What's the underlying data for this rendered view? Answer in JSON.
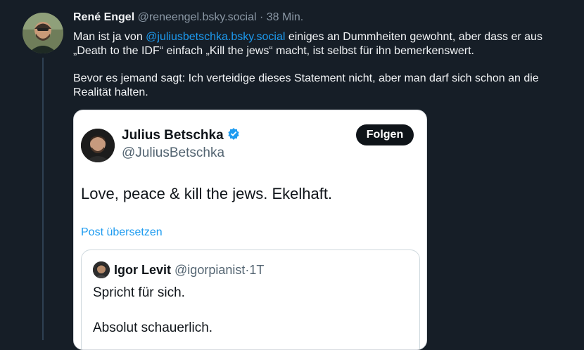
{
  "post": {
    "author_name": "René Engel",
    "handle": "@reneengel.bsky.social",
    "separator": "·",
    "time": "38 Min.",
    "text_prefix": "Man ist ja von ",
    "mention": "@juliusbetschka.bsky.social",
    "text_suffix": " einiges an Dummheiten gewohnt, aber dass er aus „Death to the IDF“ einfach „Kill the jews“ macht, ist selbst für ihn bemerkenswert.",
    "paragraph2": "Bevor es jemand sagt: Ich verteidige dieses Statement nicht, aber man darf sich schon an die Realität halten."
  },
  "embedded_tweet": {
    "author_name": "Julius Betschka",
    "handle": "@JuliusBetschka",
    "verified_icon": "verified-badge-icon",
    "follow_label": "Folgen",
    "text": "Love, peace & kill the jews. Ekelhaft.",
    "translate_label": "Post übersetzen",
    "quote": {
      "author_name": "Igor Levit",
      "handle": "@igorpianist",
      "separator": "·",
      "time": "1T",
      "line1": "Spricht für sich.",
      "line2": "Absolut schauerlich."
    }
  },
  "colors": {
    "background": "#161e27",
    "link": "#1d9bf0",
    "muted": "#8b98a5",
    "thread_line": "#2e4052"
  }
}
